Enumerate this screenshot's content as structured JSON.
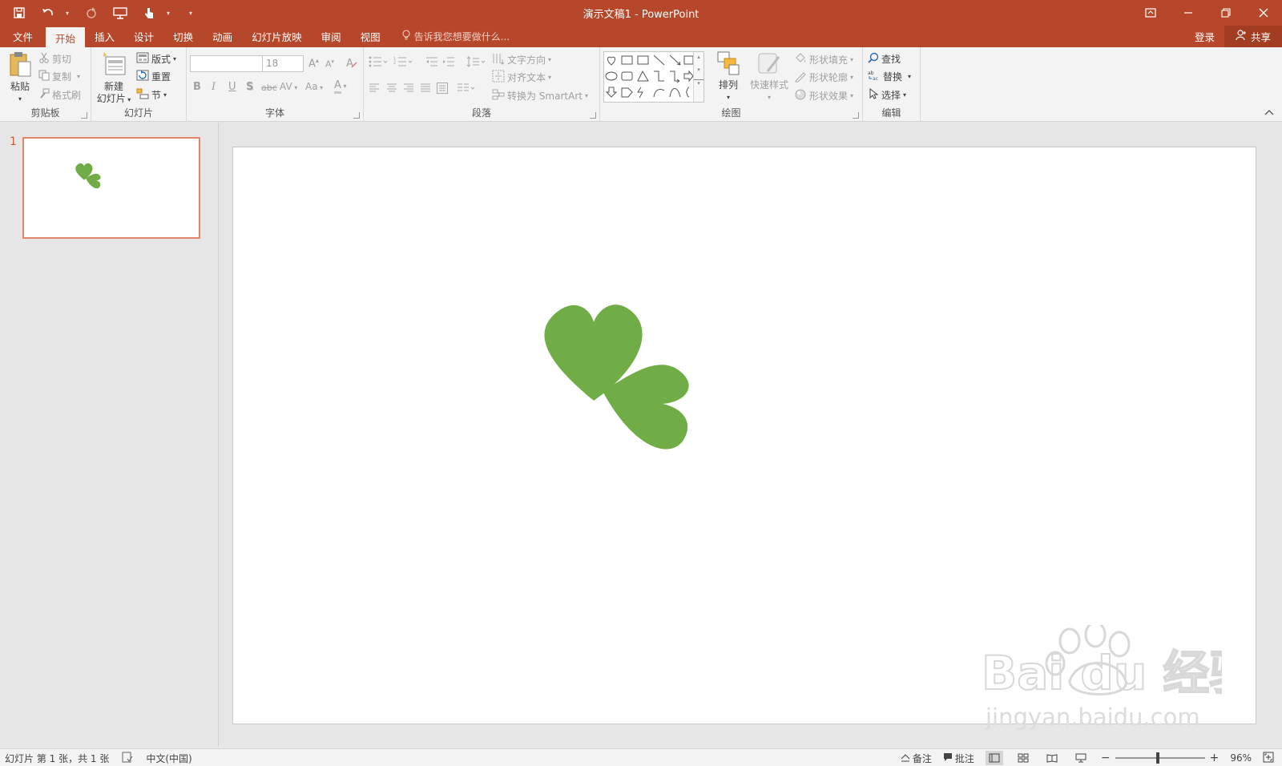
{
  "window": {
    "title": "演示文稿1 - PowerPoint"
  },
  "tabs": {
    "file": "文件",
    "items": [
      "开始",
      "插入",
      "设计",
      "切换",
      "动画",
      "幻灯片放映",
      "审阅",
      "视图"
    ],
    "active_index": 0,
    "tell_me": "告诉我您想要做什么...",
    "login": "登录",
    "share": "共享"
  },
  "ribbon": {
    "clipboard": {
      "label": "剪贴板",
      "paste": "粘贴",
      "cut": "剪切",
      "copy": "复制",
      "format_painter": "格式刷"
    },
    "slides": {
      "label": "幻灯片",
      "new_slide_line1": "新建",
      "new_slide_line2": "幻灯片",
      "layout": "版式",
      "reset": "重置",
      "section": "节"
    },
    "font": {
      "label": "字体",
      "font_name": "",
      "font_size": "18",
      "bold": "B",
      "italic": "I",
      "underline": "U",
      "shadow": "S",
      "strike": "abc",
      "spacing": "AV",
      "case": "Aa",
      "grow": "A",
      "shrink": "A",
      "color": "A"
    },
    "paragraph": {
      "label": "段落",
      "text_direction": "文字方向",
      "align_text": "对齐文本",
      "smartart": "转换为 SmartArt"
    },
    "drawing": {
      "label": "绘图",
      "arrange": "排列",
      "quick_styles": "快速样式",
      "shape_fill": "形状填充",
      "shape_outline": "形状轮廓",
      "shape_effects": "形状效果"
    },
    "editing": {
      "label": "编辑",
      "find": "查找",
      "replace": "替换",
      "select": "选择"
    }
  },
  "thumbnails": [
    {
      "number": "1"
    }
  ],
  "watermark": {
    "brand": "Bai du 经验",
    "url": "jingyan.baidu.com"
  },
  "status": {
    "slide_info": "幻灯片 第 1 张，共 1 张",
    "language": "中文(中国)",
    "notes": "备注",
    "comments": "批注",
    "zoom": "96%",
    "zoom_minus": "−",
    "zoom_plus": "+"
  },
  "colors": {
    "accent": "#b7472a",
    "shape_fill": "#70ad47"
  }
}
